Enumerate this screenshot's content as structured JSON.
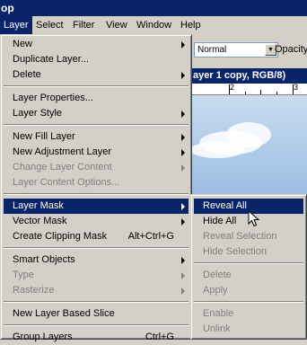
{
  "window": {
    "title": "op"
  },
  "menubar": [
    {
      "label": "Layer",
      "active": true
    },
    {
      "label": "Select"
    },
    {
      "label": "Filter"
    },
    {
      "label": "View"
    },
    {
      "label": "Window"
    },
    {
      "label": "Help"
    }
  ],
  "options_bar": {
    "blend_mode": "Normal",
    "opacity_label": "Opacity"
  },
  "document": {
    "title": "ayer 1 copy, RGB/8)",
    "ruler_marks": [
      "2",
      "3"
    ]
  },
  "layer_menu": {
    "items": [
      {
        "label": "New",
        "submenu": true
      },
      {
        "label": "Duplicate Layer..."
      },
      {
        "label": "Delete",
        "submenu": true
      },
      {
        "label": "Layer Properties..."
      },
      {
        "label": "Layer Style",
        "submenu": true
      },
      {
        "label": "New Fill Layer",
        "submenu": true
      },
      {
        "label": "New Adjustment Layer",
        "submenu": true
      },
      {
        "label": "Change Layer Content",
        "submenu": true,
        "disabled": true
      },
      {
        "label": "Layer Content Options...",
        "disabled": true
      },
      {
        "label": "Layer Mask",
        "submenu": true,
        "highlighted": true
      },
      {
        "label": "Vector Mask",
        "submenu": true
      },
      {
        "label": "Create Clipping Mask",
        "shortcut": "Alt+Ctrl+G"
      },
      {
        "label": "Smart Objects",
        "submenu": true
      },
      {
        "label": "Type",
        "submenu": true,
        "disabled": true
      },
      {
        "label": "Rasterize",
        "submenu": true,
        "disabled": true
      },
      {
        "label": "New Layer Based Slice"
      },
      {
        "label": "Group Layers",
        "shortcut": "Ctrl+G"
      }
    ]
  },
  "layer_mask_submenu": {
    "items": [
      {
        "label": "Reveal All",
        "highlighted": true
      },
      {
        "label": "Hide All"
      },
      {
        "label": "Reveal Selection",
        "disabled": true
      },
      {
        "label": "Hide Selection",
        "disabled": true
      },
      {
        "label": "Delete",
        "disabled": true
      },
      {
        "label": "Apply",
        "disabled": true
      },
      {
        "label": "Enable",
        "disabled": true
      },
      {
        "label": "Unlink",
        "disabled": true
      }
    ]
  },
  "colors": {
    "highlight": "#0a246a",
    "menu_bg": "#d4d0c8",
    "disabled_text": "#808080"
  }
}
